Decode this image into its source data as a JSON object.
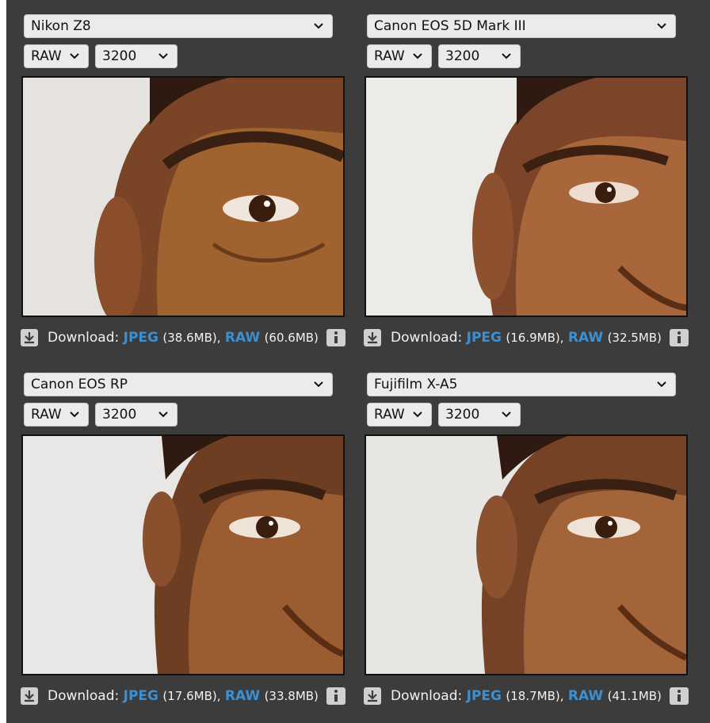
{
  "panels": [
    {
      "camera": "Nikon Z8",
      "format": "RAW",
      "iso": "3200",
      "download_label": "Download:",
      "jpeg_label": "JPEG",
      "jpeg_size": "(38.6MB),",
      "raw_label": "RAW",
      "raw_size": "(60.6MB)"
    },
    {
      "camera": "Canon EOS 5D Mark III",
      "format": "RAW",
      "iso": "3200",
      "download_label": "Download:",
      "jpeg_label": "JPEG",
      "jpeg_size": "(16.9MB),",
      "raw_label": "RAW",
      "raw_size": "(32.5MB)"
    },
    {
      "camera": "Canon EOS RP",
      "format": "RAW",
      "iso": "3200",
      "download_label": "Download:",
      "jpeg_label": "JPEG",
      "jpeg_size": "(17.6MB),",
      "raw_label": "RAW",
      "raw_size": "(33.8MB)"
    },
    {
      "camera": "Fujifilm X-A5",
      "format": "RAW",
      "iso": "3200",
      "download_label": "Download:",
      "jpeg_label": "JPEG",
      "jpeg_size": "(18.7MB),",
      "raw_label": "RAW",
      "raw_size": "(41.1MB)"
    }
  ],
  "icons": {
    "select": "chevron-down-icon",
    "download": "download-icon",
    "info": "info-icon"
  },
  "colors": {
    "background": "#3c3c3c",
    "link": "#3d8fd0",
    "select": "#ebebeb"
  }
}
